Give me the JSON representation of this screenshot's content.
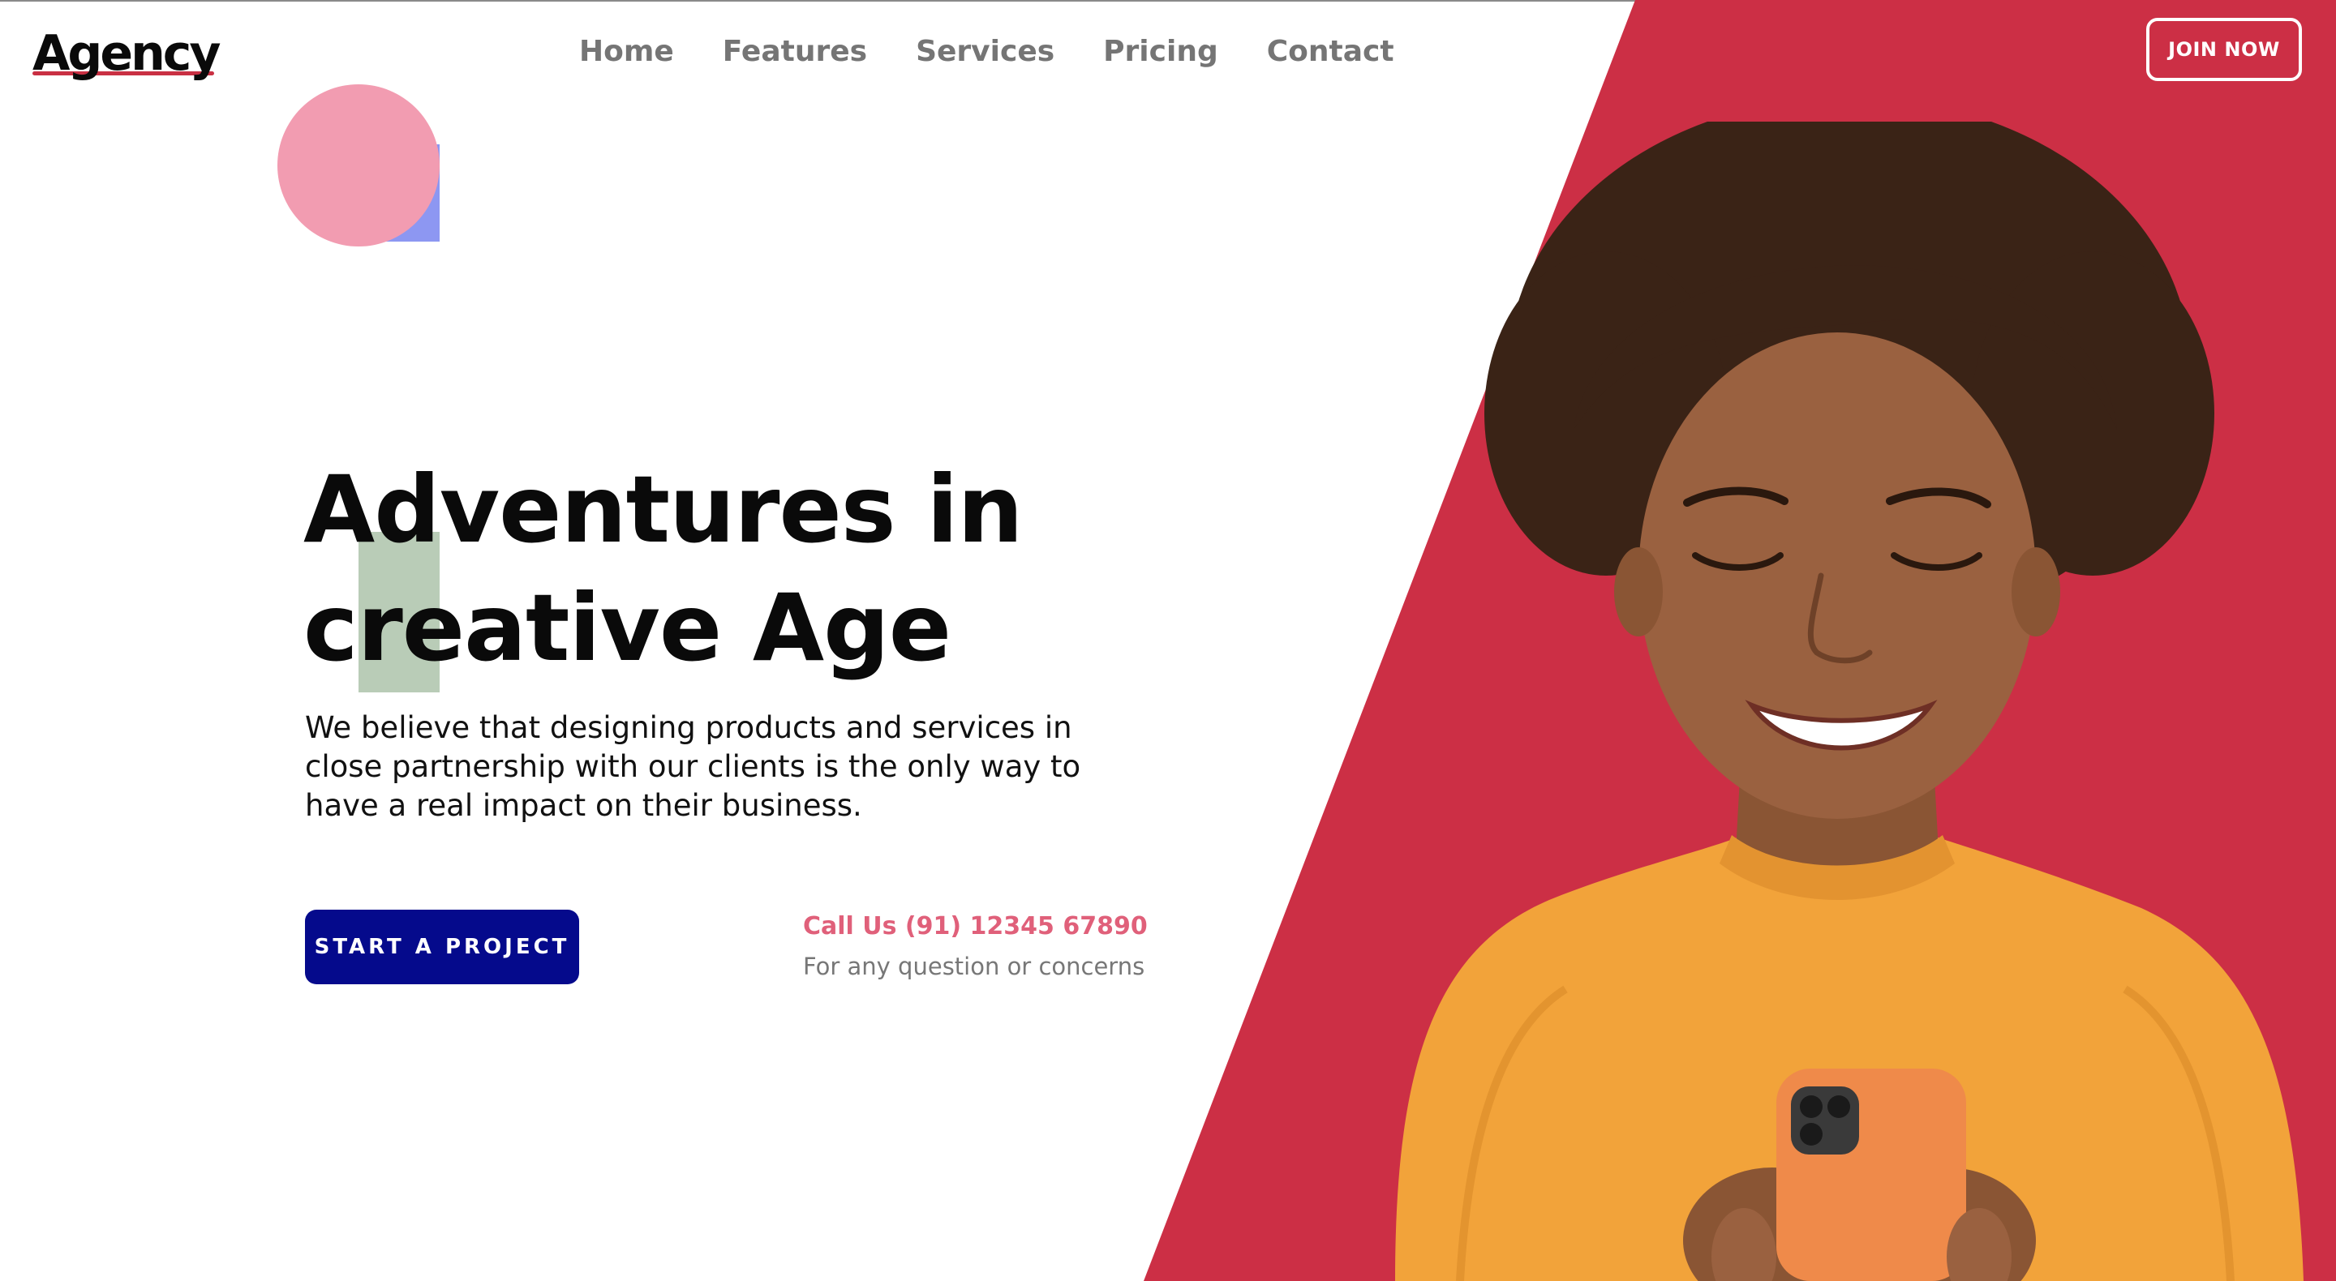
{
  "brand": {
    "name": "Agency"
  },
  "nav": {
    "items": [
      {
        "label": "Home"
      },
      {
        "label": "Features"
      },
      {
        "label": "Services"
      },
      {
        "label": "Pricing"
      },
      {
        "label": "Contact"
      }
    ]
  },
  "header": {
    "join_label": "JOIN NOW"
  },
  "hero": {
    "title_line1": "Adventures in",
    "title_line2": "creative Age",
    "description": "We believe that designing products and services in close partnership with our clients is the only way to have a real impact on their business.",
    "cta_label": "START A PROJECT",
    "call_label": "Call Us (91) 12345 67890",
    "call_subtext": "For any question or concerns"
  },
  "colors": {
    "accent_red": "#cc2f45",
    "cta_blue": "#050a8c",
    "pink_circle": "#f29cb1",
    "lavender_square": "#8d97f2",
    "sage_block": "#b9ccb7",
    "sweater_orange": "#f2a33a"
  },
  "icons": {
    "hero_image": "smiling-woman-with-phone-photo"
  }
}
